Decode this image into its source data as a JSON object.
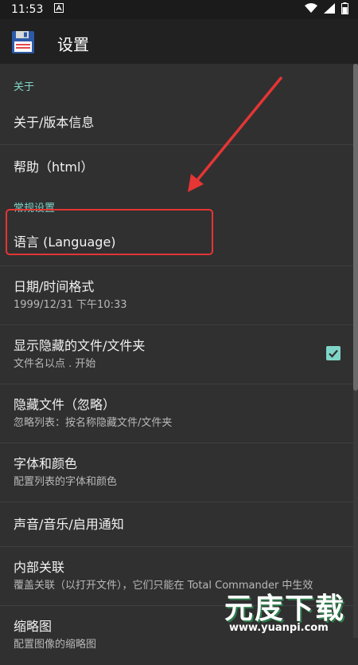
{
  "status_bar": {
    "time": "11:53",
    "icons": [
      "notification-a-icon",
      "wifi-icon",
      "signal-icon",
      "battery-icon"
    ]
  },
  "app_bar": {
    "title": "设置",
    "icon": "floppy-disk-icon"
  },
  "sections": {
    "about": {
      "header": "关于",
      "items": [
        {
          "title": "关于/版本信息"
        },
        {
          "title": "帮助（html）"
        }
      ]
    },
    "general": {
      "header": "常规设置",
      "items": [
        {
          "title": "语言 (Language)"
        },
        {
          "title": "日期/时间格式",
          "summary": "1999/12/31  下午10:33"
        },
        {
          "title": "显示隐藏的文件/文件夹",
          "summary": "文件名以点 . 开始",
          "checked": true
        },
        {
          "title": "隐藏文件（忽略）",
          "summary": "忽略列表：按名称隐藏文件/文件夹"
        },
        {
          "title": "字体和颜色",
          "summary": "配置列表的字体和颜色"
        },
        {
          "title": "声音/音乐/启用通知"
        },
        {
          "title": "内部关联",
          "summary": "覆盖关联（以打开文件），它们只能在 Total Commander 中生效"
        },
        {
          "title": "缩略图",
          "summary": "配置图像的缩略图"
        }
      ]
    }
  },
  "watermark": {
    "text": "元庋下载",
    "url": "www.yuanpi.com"
  },
  "colors": {
    "accent": "#7fd5c8",
    "background": "#303030",
    "app_bar": "#212121",
    "annotation": "#e53535"
  }
}
